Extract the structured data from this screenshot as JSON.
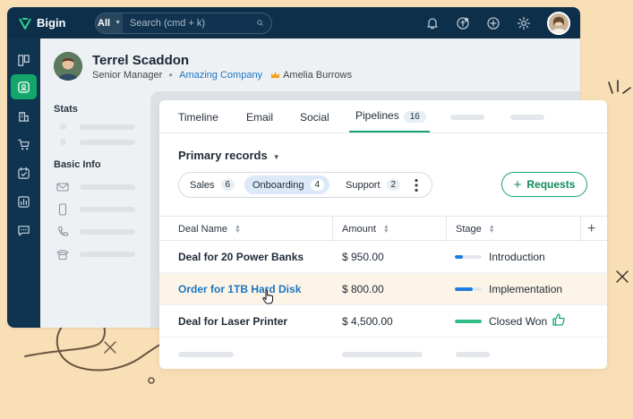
{
  "topbar": {
    "brand": "Bigin",
    "search_scope": "All",
    "search_placeholder": "Search (cmd + k)",
    "icons": [
      "bell-icon",
      "gift-icon",
      "plus-circle-icon",
      "gear-icon"
    ]
  },
  "nav": {
    "items": [
      "pipelines-icon",
      "contacts-icon",
      "companies-icon",
      "products-icon",
      "activities-icon",
      "reports-icon",
      "chat-icon"
    ],
    "active": "contacts-icon"
  },
  "contact": {
    "name": "Terrel Scaddon",
    "title": "Senior Manager",
    "company": "Amazing Company",
    "owner": "Amelia Burrows"
  },
  "sidebar": {
    "stats_title": "Stats",
    "basic_info_title": "Basic Info"
  },
  "tabs": [
    {
      "label": "Timeline"
    },
    {
      "label": "Email"
    },
    {
      "label": "Social"
    },
    {
      "label": "Pipelines",
      "count": "16",
      "active": true
    }
  ],
  "records": {
    "title": "Primary records",
    "pills": [
      {
        "label": "Sales",
        "count": "6"
      },
      {
        "label": "Onboarding",
        "count": "4",
        "selected": true
      },
      {
        "label": "Support",
        "count": "2"
      }
    ],
    "requests_label": "Requests"
  },
  "table": {
    "columns": [
      "Deal Name",
      "Amount",
      "Stage"
    ],
    "rows": [
      {
        "deal": "Deal for 20 Power Banks",
        "amount": "$ 950.00",
        "stage": "Introduction",
        "progress": 0.3
      },
      {
        "deal": "Order for 1TB Hard Disk",
        "amount": "$ 800.00",
        "stage": "Implementation",
        "progress": 0.65
      },
      {
        "deal": "Deal for Laser Printer",
        "amount": "$ 4,500.00",
        "stage": "Closed Won",
        "progress": 1.0
      }
    ]
  },
  "colors": {
    "topbar": "#0d2f4a",
    "accent_green": "#13a66b",
    "link_blue": "#1b76c2",
    "background": "#f9dfb6"
  }
}
